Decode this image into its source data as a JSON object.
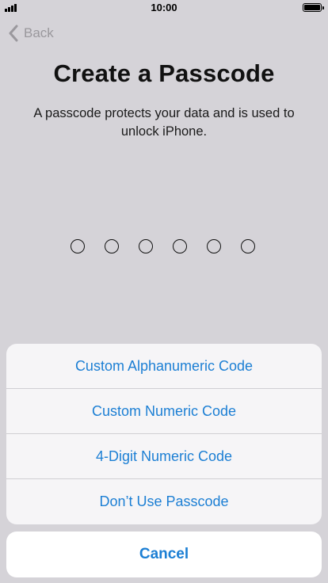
{
  "status_bar": {
    "time": "10:00",
    "battery_level": 1.0
  },
  "nav": {
    "back_label": "Back"
  },
  "page": {
    "title": "Create a Passcode",
    "description": "A passcode protects your data and is used to unlock iPhone."
  },
  "passcode": {
    "entered": 0,
    "length": 6
  },
  "action_sheet": {
    "options": [
      "Custom Alphanumeric Code",
      "Custom Numeric Code",
      "4-Digit Numeric Code",
      "Don’t Use Passcode"
    ],
    "cancel_label": "Cancel"
  },
  "colors": {
    "accent": "#1c7fd4",
    "background_dimmed": "#d5d3d8",
    "sheet_background": "#f6f5f7",
    "back_tint": "#9a989d"
  },
  "icons": {
    "back": "chevron-left-icon",
    "signal": "cellular-signal-icon",
    "battery": "battery-icon"
  }
}
